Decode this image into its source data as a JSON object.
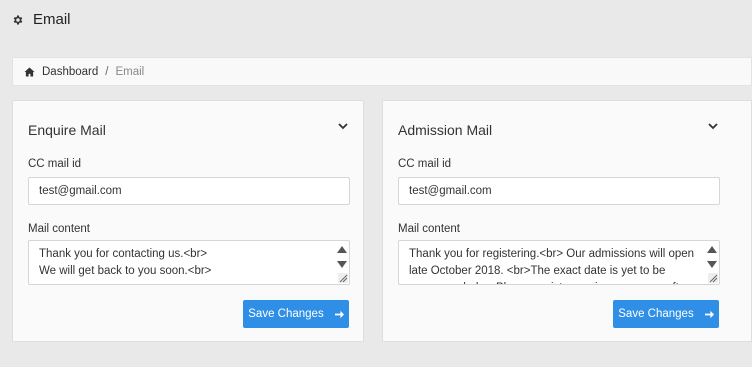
{
  "header": {
    "title": "Email",
    "icon": "gear-icon"
  },
  "breadcrumb": {
    "home_icon": "home-icon",
    "link": "Dashboard",
    "separator": "/",
    "current": "Email"
  },
  "cards": [
    {
      "title": "Enquire Mail",
      "cc_label": "CC mail id",
      "cc_value": "test@gmail.com",
      "content_label": "Mail content",
      "content_value": "Thank you for contacting us.<br>\nWe will get back to you soon.<br>",
      "save_label": "Save Changes"
    },
    {
      "title": "Admission Mail",
      "cc_label": "CC mail id",
      "cc_value": "test@gmail.com",
      "content_label": "Mail content",
      "content_value": "Thank you for registering.<br> Our admissions will open late October 2018. <br>The exact date is yet to be announced.<br> Please register again as soon as after the registration date",
      "save_label": "Save Changes"
    }
  ],
  "colors": {
    "primary_button": "#2f8fe6",
    "background": "#e9e9e9"
  }
}
